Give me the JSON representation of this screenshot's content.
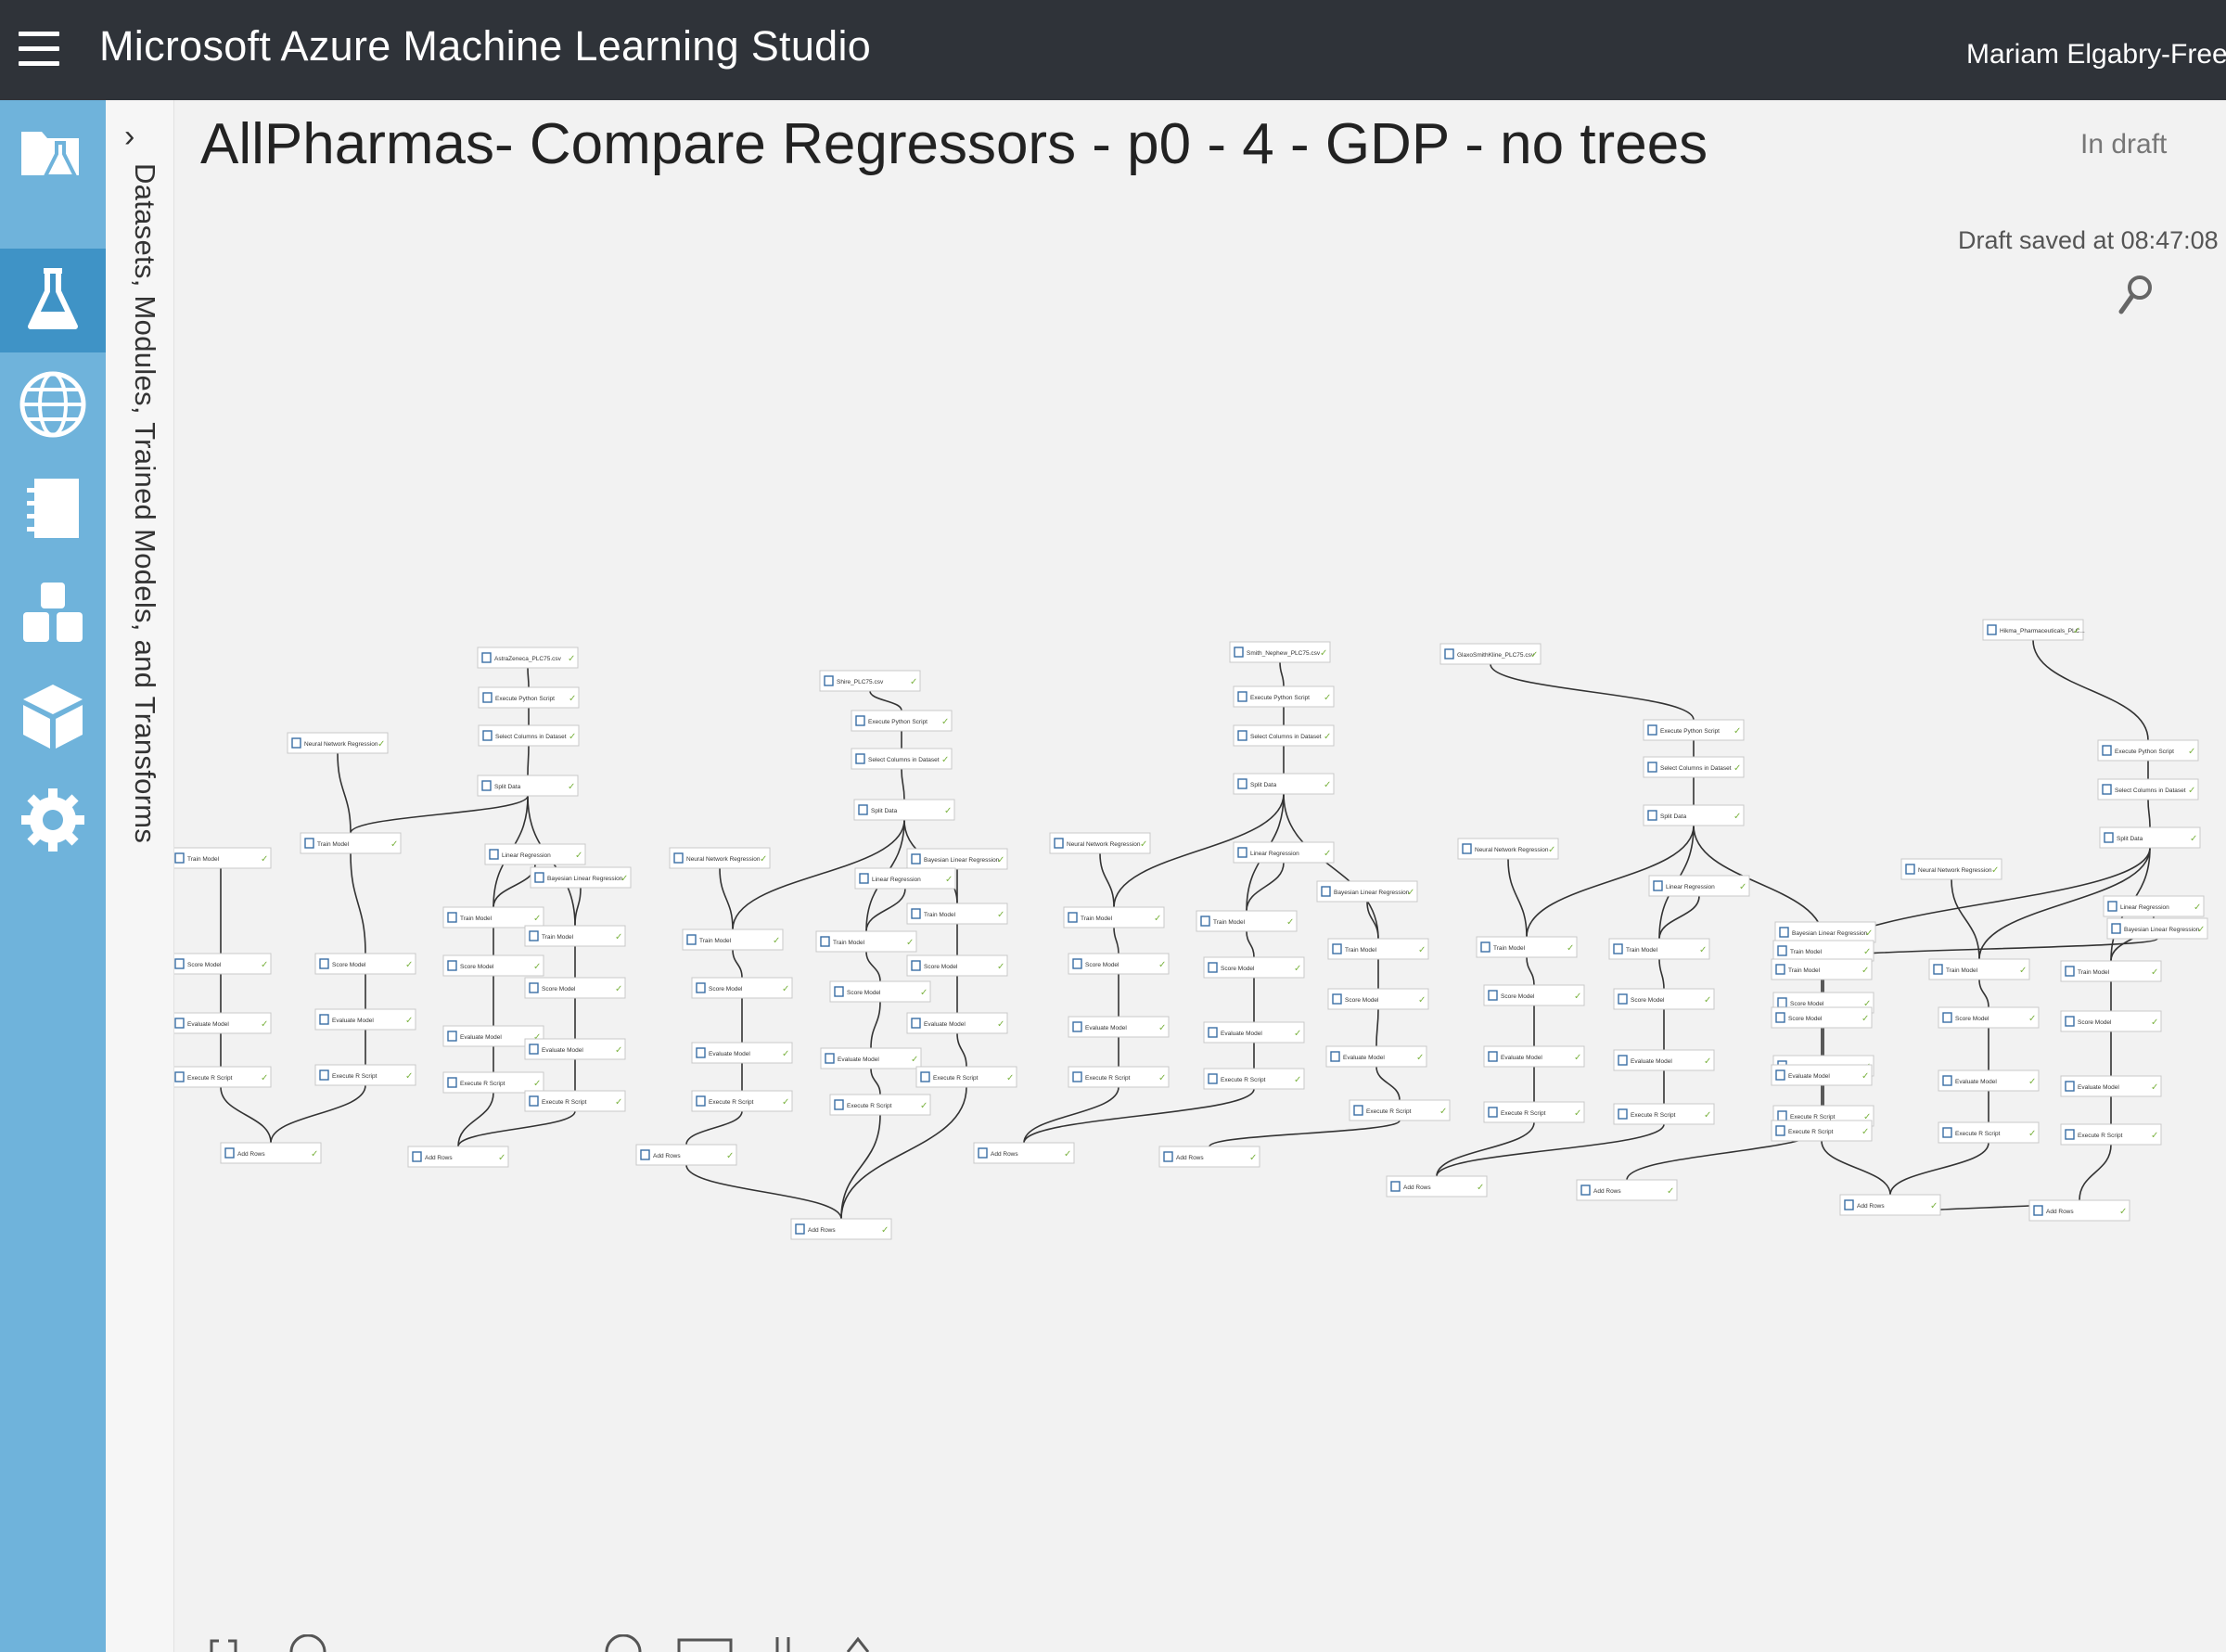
{
  "app": {
    "title": "Microsoft Azure Machine Learning Studio",
    "user": "Mariam Elgabry-Free-V"
  },
  "left_nav": {
    "items": [
      {
        "name": "projects",
        "icon": "folder-flask-icon"
      },
      {
        "name": "experiments",
        "icon": "flask-icon",
        "active": true
      },
      {
        "name": "web-services",
        "icon": "globe-icon"
      },
      {
        "name": "notebooks",
        "icon": "notebook-icon"
      },
      {
        "name": "datasets",
        "icon": "datasets-icon"
      },
      {
        "name": "trained-models",
        "icon": "cube-icon"
      },
      {
        "name": "settings",
        "icon": "gear-icon"
      }
    ]
  },
  "palette": {
    "label": "Datasets, Modules, Trained Models, and Transforms",
    "toggle_icon": "chevron-right-icon"
  },
  "experiment": {
    "title": "AllPharmas- Compare Regressors - p0  - 4 - GDP - no trees",
    "status": "In draft",
    "draft_saved": "Draft saved at 08:47:08"
  },
  "graph": {
    "modules": [
      {
        "label": "AstraZeneca_PLC75.csv"
      },
      {
        "label": "Execute Python Script"
      },
      {
        "label": "Select Columns in Dataset"
      },
      {
        "label": "Split Data"
      },
      {
        "label": "Neural Network Regression"
      },
      {
        "label": "Linear Regression"
      },
      {
        "label": "Bayesian Linear Regression"
      },
      {
        "label": "Train Model"
      },
      {
        "label": "Score Model"
      },
      {
        "label": "Evaluate Model"
      },
      {
        "label": "Execute R Script"
      },
      {
        "label": "Add Rows"
      },
      {
        "label": "Shire_PLC75.csv"
      },
      {
        "label": "Smith_Nephew_PLC75.csv"
      },
      {
        "label": "GlaxoSmithKline_PLC75.csv"
      },
      {
        "label": "Hikma_Pharmaceuticals_PLC..."
      }
    ]
  },
  "colors": {
    "topbar": "#2f3339",
    "left_nav": "#6fb3db",
    "left_nav_active": "#3f93c6",
    "canvas": "#f2f2f2",
    "check": "#7cb342"
  }
}
